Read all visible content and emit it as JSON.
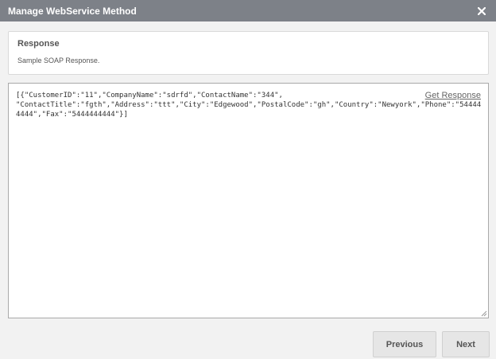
{
  "dialog": {
    "title": "Manage WebService Method",
    "close_icon": "close-icon"
  },
  "info": {
    "heading": "Response",
    "description": "Sample SOAP Response."
  },
  "response": {
    "text": "[{\"CustomerID\":\"11\",\"CompanyName\":\"sdrfd\",\"ContactName\":\"344\",\n\"ContactTitle\":\"fgth\",\"Address\":\"ttt\",\"City\":\"Edgewood\",\"PostalCode\":\"gh\",\"Country\":\"Newyork\",\"Phone\":\"544444444\",\"Fax\":\"5444444444\"}]",
    "get_response_label": "Get Response"
  },
  "footer": {
    "previous_label": "Previous",
    "next_label": "Next"
  },
  "colors": {
    "titlebar": "#7d8188",
    "background": "#f2f2f2",
    "button": "#e6e6e6"
  }
}
